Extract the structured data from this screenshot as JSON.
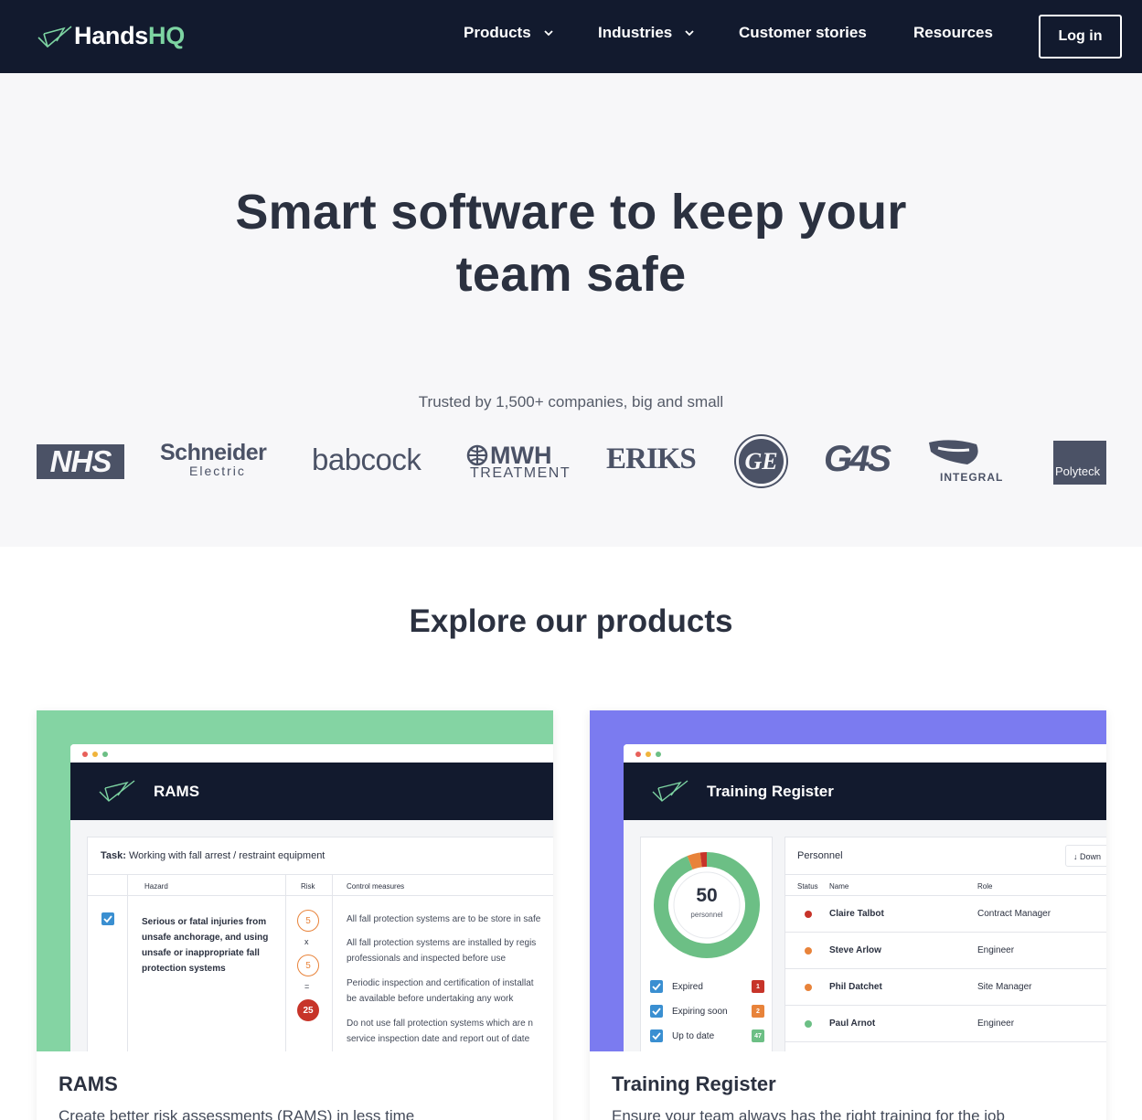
{
  "nav": {
    "logo_word": "Hands",
    "logo_hq": "HQ",
    "items": [
      {
        "label": "Products",
        "has_dropdown": true
      },
      {
        "label": "Industries",
        "has_dropdown": true
      },
      {
        "label": "Customer stories",
        "has_dropdown": false
      },
      {
        "label": "Resources",
        "has_dropdown": false
      }
    ],
    "login": "Log in"
  },
  "hero": {
    "title_line1": "Smart software to keep your",
    "title_line2": "team safe",
    "trusted": "Trusted by 1,500+ companies, big and small",
    "logos": [
      "NHS",
      "Schneider",
      "Electric",
      "babcock",
      "MWH",
      "TREATMENT",
      "ERIKS",
      "GE",
      "G4S",
      "INTEGRAL",
      "Polyteck"
    ]
  },
  "products": {
    "heading": "Explore our products",
    "cards": [
      {
        "name": "RAMS",
        "app_title": "RAMS",
        "description": "Create better risk assessments (RAMS) in less time",
        "accent": "#84d4a3",
        "task_label": "Task:",
        "task_value": "Working with fall arrest / restraint equipment",
        "columns": [
          "Hazard",
          "Risk",
          "Control measures"
        ],
        "hazard": "Serious or fatal injuries from unsafe anchorage, and using unsafe or inappropriate fall protection systems",
        "risk": {
          "likelihood": "5",
          "op1": "x",
          "severity": "5",
          "op2": "=",
          "score": "25"
        },
        "controls": [
          "All fall protection systems are to be store in safe",
          "All fall protection systems are installed by regis",
          "professionals and inspected before use",
          "Periodic inspection and certification of installat",
          "be available before undertaking any work",
          "Do not use fall protection systems which are n",
          "service inspection date and report out of date"
        ]
      },
      {
        "name": "Training Register",
        "app_title": "Training Register",
        "description": "Ensure your team always has the right training for the job",
        "accent": "#7b7bf0",
        "total": "50",
        "total_label": "personnel",
        "legend": [
          {
            "label": "Expired",
            "count": "1",
            "color": "#c73429"
          },
          {
            "label": "Expiring soon",
            "count": "2",
            "color": "#e8833a"
          },
          {
            "label": "Up to date",
            "count": "47",
            "color": "#6cbf85"
          }
        ],
        "panel_title": "Personnel",
        "download": "Down",
        "columns": [
          "Status",
          "Name",
          "Role"
        ],
        "people": [
          {
            "name": "Claire Talbot",
            "role": "Contract Manager",
            "status_color": "#c73429"
          },
          {
            "name": "Steve Arlow",
            "role": "Engineer",
            "status_color": "#e8833a"
          },
          {
            "name": "Phil Datchet",
            "role": "Site Manager",
            "status_color": "#e8833a"
          },
          {
            "name": "Paul Arnot",
            "role": "Engineer",
            "status_color": "#6cbf85"
          }
        ]
      }
    ]
  }
}
